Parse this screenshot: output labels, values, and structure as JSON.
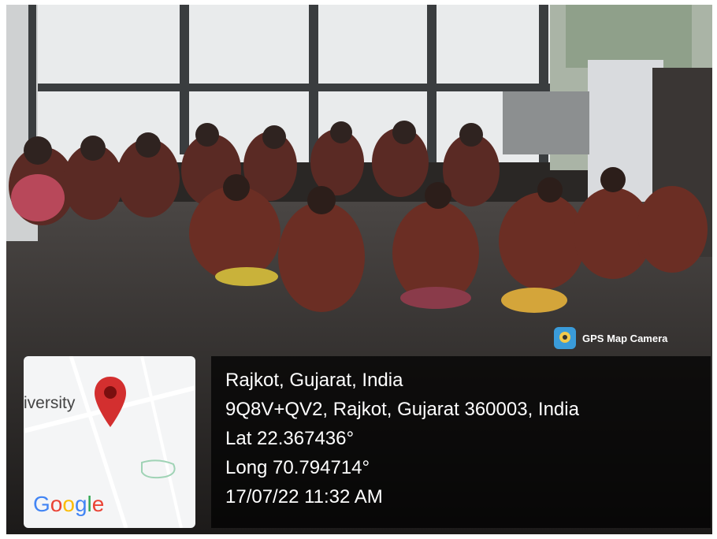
{
  "overlay": {
    "app_name": "GPS Map Camera",
    "app_icon": "camera-map-icon",
    "colors": {
      "panel": "#000000",
      "text": "#ffffff",
      "pin": "#d32f2f"
    }
  },
  "map": {
    "place_label": "iversity",
    "logo": "Google",
    "pin_icon": "map-pin-icon"
  },
  "location": {
    "city_line": "Rajkot, Gujarat, India",
    "address": "9Q8V+QV2, Rajkot, Gujarat 360003, India",
    "lat": "Lat 22.367436°",
    "long": "Long 70.794714°",
    "datetime": "17/07/22 11:32 AM"
  }
}
